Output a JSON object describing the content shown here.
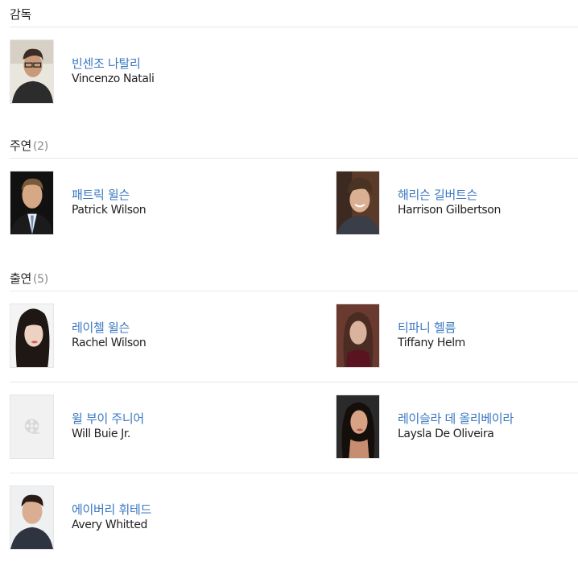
{
  "director": {
    "title": "감독",
    "people": [
      {
        "name_ko": "빈센조 나탈리",
        "name_en": "Vincenzo Natali"
      }
    ]
  },
  "lead": {
    "title": "주연",
    "count": "(2)",
    "people": [
      {
        "name_ko": "패트릭 윌슨",
        "name_en": "Patrick Wilson"
      },
      {
        "name_ko": "해리슨 길버트슨",
        "name_en": "Harrison Gilbertson"
      }
    ]
  },
  "cast": {
    "title": "출연",
    "count": "(5)",
    "people": [
      {
        "name_ko": "레이첼 윌슨",
        "name_en": "Rachel Wilson"
      },
      {
        "name_ko": "티파니 헬름",
        "name_en": "Tiffany Helm"
      },
      {
        "name_ko": "윌 부이 주니어",
        "name_en": "Will Buie Jr."
      },
      {
        "name_ko": "레이슬라 데 올리베이라",
        "name_en": "Laysla De Oliveira"
      },
      {
        "name_ko": "에이버리 휘테드",
        "name_en": "Avery Whitted"
      }
    ]
  },
  "colors": {
    "link": "#3a78c2",
    "divider": "#e8e8e8",
    "count": "#888888"
  }
}
